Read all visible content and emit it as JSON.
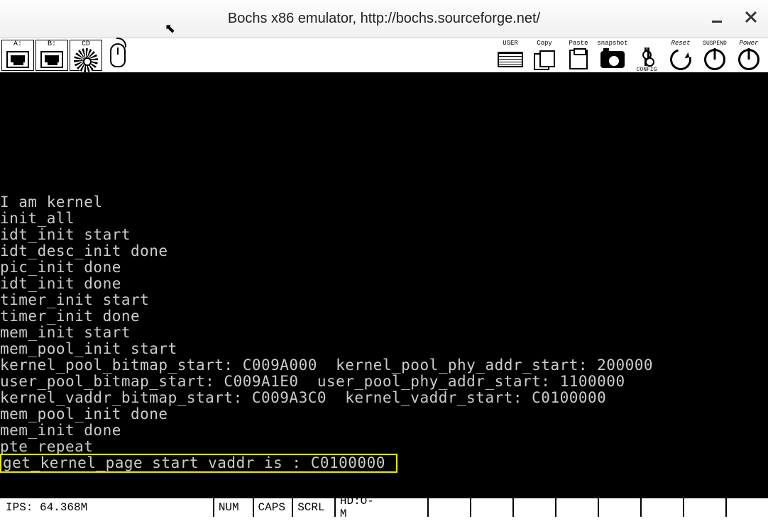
{
  "window": {
    "title": "Bochs x86 emulator, http://bochs.sourceforge.net/"
  },
  "toolbar": {
    "drives": {
      "a_label": "A:",
      "b_label": "B:",
      "cd_label": "CD"
    },
    "right": {
      "user": "USER",
      "copy": "Copy",
      "paste": "Paste",
      "snapshot": "snapshot",
      "config": "CONFIG",
      "reset": "Reset",
      "suspend": "SUSPEND",
      "power": "Power"
    }
  },
  "console": {
    "lines": [
      "I am kernel",
      "init_all",
      "idt_init start",
      "idt_desc_init done",
      "pic_init done",
      "idt_init done",
      "timer_init start",
      "timer_init done",
      "mem_init start",
      "mem_pool_init start",
      "kernel_pool_bitmap_start: C009A000  kernel_pool_phy_addr_start: 200000",
      "user_pool_bitmap_start: C009A1E0  user_pool_phy_addr_start: 1100000",
      "kernel_vaddr_bitmap_start: C009A3C0  kernel_vaddr_start: C0100000",
      "mem_pool_init done",
      "mem_init done",
      "pte repeat"
    ],
    "highlighted": "get_kernel_page start vaddr is : C0100000 "
  },
  "status": {
    "ips": "IPS: 64.368M",
    "num": "NUM",
    "caps": "CAPS",
    "scrl": "SCRL",
    "hd": "HD:O-M"
  }
}
